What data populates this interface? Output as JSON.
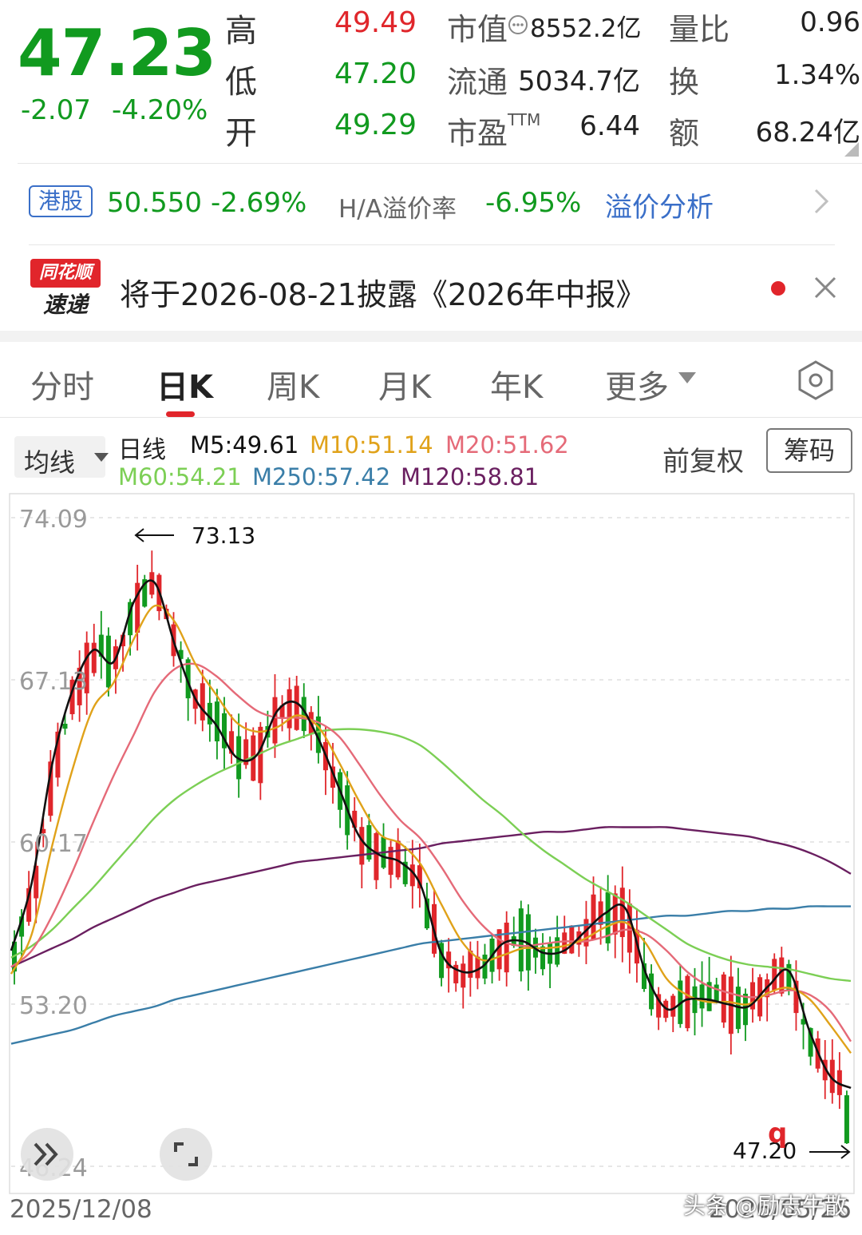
{
  "quote": {
    "price": "47.23",
    "change": "-2.07",
    "change_pct": "-4.20%",
    "high_label": "高",
    "high": "49.49",
    "low_label": "低",
    "low": "47.20",
    "open_label": "开",
    "open": "49.29",
    "mcap_label": "市值",
    "mcap": "8552.2亿",
    "float_label": "流通",
    "float": "5034.7亿",
    "pe_label": "市盈",
    "pe_sup": "TTM",
    "pe": "6.44",
    "vol_ratio_label": "量比",
    "vol_ratio": "0.96",
    "turnover_label": "换",
    "turnover": "1.34%",
    "amount_label": "额",
    "amount": "68.24亿"
  },
  "hk": {
    "tag": "港股",
    "price": "50.550",
    "change_pct": "-2.69%",
    "ha_label": "H/A溢价率",
    "ha_value": "-6.95%",
    "link": "溢价分析"
  },
  "notice": {
    "logo_top": "同花顺",
    "logo_bottom": "速递",
    "text": "将于2026-08-21披露《2026年中报》"
  },
  "tabs": [
    {
      "label": "分时",
      "active": false
    },
    {
      "label": "日K",
      "active": true
    },
    {
      "label": "周K",
      "active": false
    },
    {
      "label": "月K",
      "active": false
    },
    {
      "label": "年K",
      "active": false
    },
    {
      "label": "更多",
      "active": false
    }
  ],
  "legend": {
    "select": "均线",
    "type": "日线",
    "m5": "M5:49.61",
    "m10": "M10:51.14",
    "m20": "M20:51.62",
    "m60": "M60:54.21",
    "m250": "M250:57.42",
    "m120": "M120:58.81",
    "fuquan": "前复权",
    "chouma": "筹码"
  },
  "colors": {
    "up": "#e0262b",
    "down": "#119a1f",
    "link": "#3a6fc8",
    "m5": "#111111",
    "m10": "#e0a21a",
    "m20": "#e56a78",
    "m60": "#7ccf55",
    "m250": "#3a7ea8",
    "m120": "#6a1f60"
  },
  "chart_data": {
    "type": "candlestick",
    "y_ticks": [
      "74.09",
      "67.13",
      "60.17",
      "53.20",
      "46.24"
    ],
    "ylim": [
      46.24,
      74.09
    ],
    "x_start": "2025/12/08",
    "x_end": "2026/05/26",
    "max_annotation": "73.13",
    "min_annotation": "47.20",
    "marker": "q",
    "watermark": "头条 @励志牛散",
    "ma_series": [
      {
        "name": "M5",
        "values": [
          55.5,
          58.4,
          63.5,
          66.7,
          68.4,
          67.9,
          70.5,
          71.3,
          68.6,
          66.3,
          65.2,
          63.8,
          63.9,
          65.8,
          66.1,
          64.6,
          62.5,
          60.4,
          59.6,
          59.3,
          58.3,
          55.4,
          54.6,
          54.8,
          55.8,
          55.9,
          55.4,
          55.5,
          56.3,
          57.1,
          57.3,
          54.5,
          53.0,
          53.4,
          53.4,
          53.2,
          53.1,
          54.0,
          54.6,
          52.0,
          50.1,
          49.6
        ]
      },
      {
        "name": "M10",
        "values": [
          54.5,
          56.2,
          60.0,
          63.3,
          65.9,
          67.0,
          68.9,
          70.3,
          69.6,
          67.8,
          66.5,
          65.3,
          64.9,
          65.1,
          65.6,
          65.1,
          63.6,
          61.9,
          60.5,
          60.1,
          59.2,
          57.5,
          55.9,
          55.1,
          55.3,
          55.6,
          55.6,
          55.7,
          56.0,
          56.5,
          56.7,
          55.8,
          54.3,
          53.6,
          53.3,
          53.3,
          53.2,
          53.7,
          53.9,
          53.4,
          52.3,
          51.1
        ]
      },
      {
        "name": "M20",
        "values": [
          54.8,
          55.5,
          57.0,
          58.9,
          61.0,
          63.0,
          64.8,
          66.6,
          67.6,
          67.8,
          67.3,
          66.5,
          65.8,
          65.5,
          65.5,
          65.3,
          64.7,
          63.5,
          62.2,
          61.1,
          60.3,
          59.1,
          57.7,
          56.6,
          55.9,
          55.7,
          55.8,
          55.9,
          55.9,
          56.1,
          56.4,
          56.2,
          55.5,
          54.6,
          54.0,
          53.7,
          53.5,
          53.6,
          53.8,
          53.6,
          52.9,
          51.6
        ]
      },
      {
        "name": "M60",
        "values": [
          55.2,
          55.7,
          56.4,
          57.3,
          58.2,
          59.2,
          60.2,
          61.2,
          62.0,
          62.6,
          63.1,
          63.5,
          63.9,
          64.3,
          64.6,
          64.9,
          65.0,
          65.0,
          64.9,
          64.7,
          64.3,
          63.6,
          62.8,
          62.0,
          61.3,
          60.5,
          59.8,
          59.2,
          58.6,
          58.1,
          57.6,
          57.0,
          56.4,
          55.8,
          55.4,
          55.1,
          54.9,
          54.8,
          54.7,
          54.5,
          54.3,
          54.2
        ]
      },
      {
        "name": "M120",
        "values": [
          54.8,
          55.2,
          55.6,
          56.0,
          56.5,
          56.9,
          57.3,
          57.7,
          58.0,
          58.3,
          58.5,
          58.7,
          58.9,
          59.1,
          59.3,
          59.4,
          59.5,
          59.6,
          59.7,
          59.8,
          59.9,
          60.1,
          60.2,
          60.3,
          60.4,
          60.5,
          60.6,
          60.6,
          60.7,
          60.8,
          60.8,
          60.8,
          60.8,
          60.7,
          60.6,
          60.5,
          60.4,
          60.2,
          60.0,
          59.7,
          59.3,
          58.8
        ]
      },
      {
        "name": "M250",
        "values": [
          51.5,
          51.7,
          51.9,
          52.1,
          52.4,
          52.7,
          52.9,
          53.1,
          53.4,
          53.6,
          53.8,
          54.0,
          54.2,
          54.4,
          54.6,
          54.8,
          55.0,
          55.2,
          55.4,
          55.6,
          55.8,
          55.9,
          56.0,
          56.1,
          56.2,
          56.3,
          56.4,
          56.5,
          56.6,
          56.7,
          56.8,
          56.9,
          57.0,
          57.0,
          57.1,
          57.2,
          57.2,
          57.3,
          57.3,
          57.4,
          57.4,
          57.4
        ]
      }
    ]
  }
}
